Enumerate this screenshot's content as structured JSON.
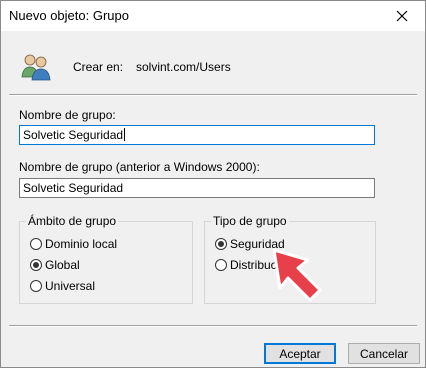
{
  "window": {
    "title": "Nuevo objeto: Grupo"
  },
  "header": {
    "crear_en_label": "Crear en:",
    "crear_en_value": "solvint.com/Users"
  },
  "fields": {
    "group_name_label": "Nombre de grupo:",
    "group_name_value": "Solvetic Seguridad",
    "group_name_pre2000_label": "Nombre de grupo (anterior a Windows 2000):",
    "group_name_pre2000_value": "Solvetic Seguridad"
  },
  "scope": {
    "title": "Ámbito de grupo",
    "options": [
      {
        "label": "Dominio local",
        "selected": false
      },
      {
        "label": "Global",
        "selected": true
      },
      {
        "label": "Universal",
        "selected": false
      }
    ]
  },
  "type": {
    "title": "Tipo de grupo",
    "options": [
      {
        "label": "Seguridad",
        "selected": true
      },
      {
        "label": "Distribución",
        "selected": false
      }
    ]
  },
  "buttons": {
    "ok": "Aceptar",
    "cancel": "Cancelar"
  },
  "colors": {
    "accent": "#0078d7",
    "pointer_arrow": "#e8404b"
  }
}
